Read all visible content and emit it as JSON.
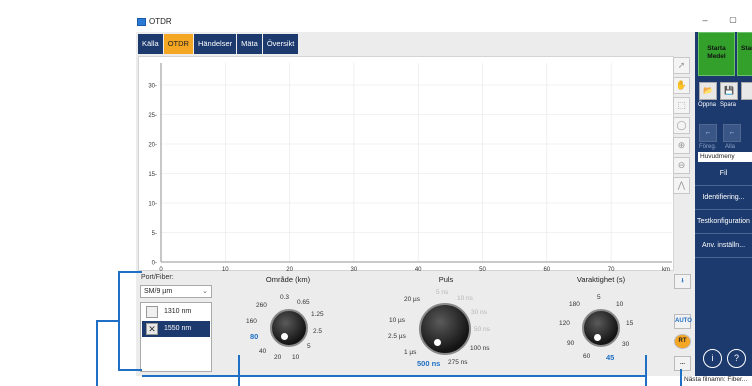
{
  "window": {
    "title": "OTDR",
    "minimize": "–",
    "maximize": "▢"
  },
  "tabs": [
    {
      "label": "Källa",
      "active": false
    },
    {
      "label": "OTDR",
      "active": true
    },
    {
      "label": "Händelser",
      "active": false
    },
    {
      "label": "Mäta",
      "active": false
    },
    {
      "label": "Översikt",
      "active": false
    }
  ],
  "graph": {
    "y_ticks": [
      "30",
      "25",
      "20",
      "15",
      "10",
      "5",
      "0"
    ],
    "x_ticks": [
      "0",
      "10",
      "20",
      "30",
      "40",
      "50",
      "60",
      "70"
    ],
    "x_unit": "km",
    "tools": [
      "cursor-icon",
      "hand-icon",
      "zoom-area-icon",
      "zoom-reset-icon",
      "zoom-in-icon",
      "zoom-out-icon",
      "fit-icon"
    ]
  },
  "port": {
    "label": "Port/Fiber:",
    "selected": "SM/9 µm",
    "wavelengths": [
      {
        "label": "1310 nm",
        "checked": false,
        "selected": false
      },
      {
        "label": "1550 nm",
        "checked": true,
        "selected": true
      }
    ]
  },
  "range": {
    "title": "Område (km)",
    "ticks": [
      "0.3",
      "260",
      "0.65",
      "160",
      "1.25",
      "80",
      "2.5",
      "40",
      "5",
      "20",
      "10"
    ],
    "selected": "80"
  },
  "pulse": {
    "title": "Puls",
    "ticks": [
      "5 ns",
      "20 µs",
      "10 ns",
      "10 µs",
      "30 ns",
      "2.5 µs",
      "50 ns",
      "1 µs",
      "100 ns",
      "500 ns",
      "275 ns"
    ],
    "selected": "500 ns"
  },
  "duration": {
    "title": "Varaktighet (s)",
    "ticks": [
      "5",
      "180",
      "10",
      "120",
      "15",
      "90",
      "30",
      "60",
      "45"
    ],
    "selected": "45"
  },
  "small_tools": {
    "export": "⭳",
    "auto": "AUTO",
    "rt": "RT",
    "more": "..."
  },
  "right_panel": {
    "start_buttons": [
      "Starta Medel",
      "Starta RT"
    ],
    "tools": [
      {
        "label": "Öppna",
        "icon": "open-folder-icon",
        "enabled": true
      },
      {
        "label": "Spara",
        "icon": "save-icon",
        "enabled": true
      },
      {
        "label": "Föreg.",
        "icon": "previous-trace-icon",
        "enabled": false
      },
      {
        "label": "Alla",
        "icon": "all-traces-icon",
        "enabled": false
      }
    ],
    "menu_title": "Huvudmeny",
    "menu_items": [
      "Fil",
      "Identifiering...",
      "Testkonfiguration",
      "Anv. inställn..."
    ],
    "round_buttons": [
      "i",
      "?"
    ]
  },
  "status": {
    "next_file": "Nästa filnamn: Fiber..."
  },
  "colors": {
    "navy": "#1c3a6e",
    "orange": "#f5a623",
    "green": "#33a02c",
    "accent_blue": "#1f6fc4"
  }
}
